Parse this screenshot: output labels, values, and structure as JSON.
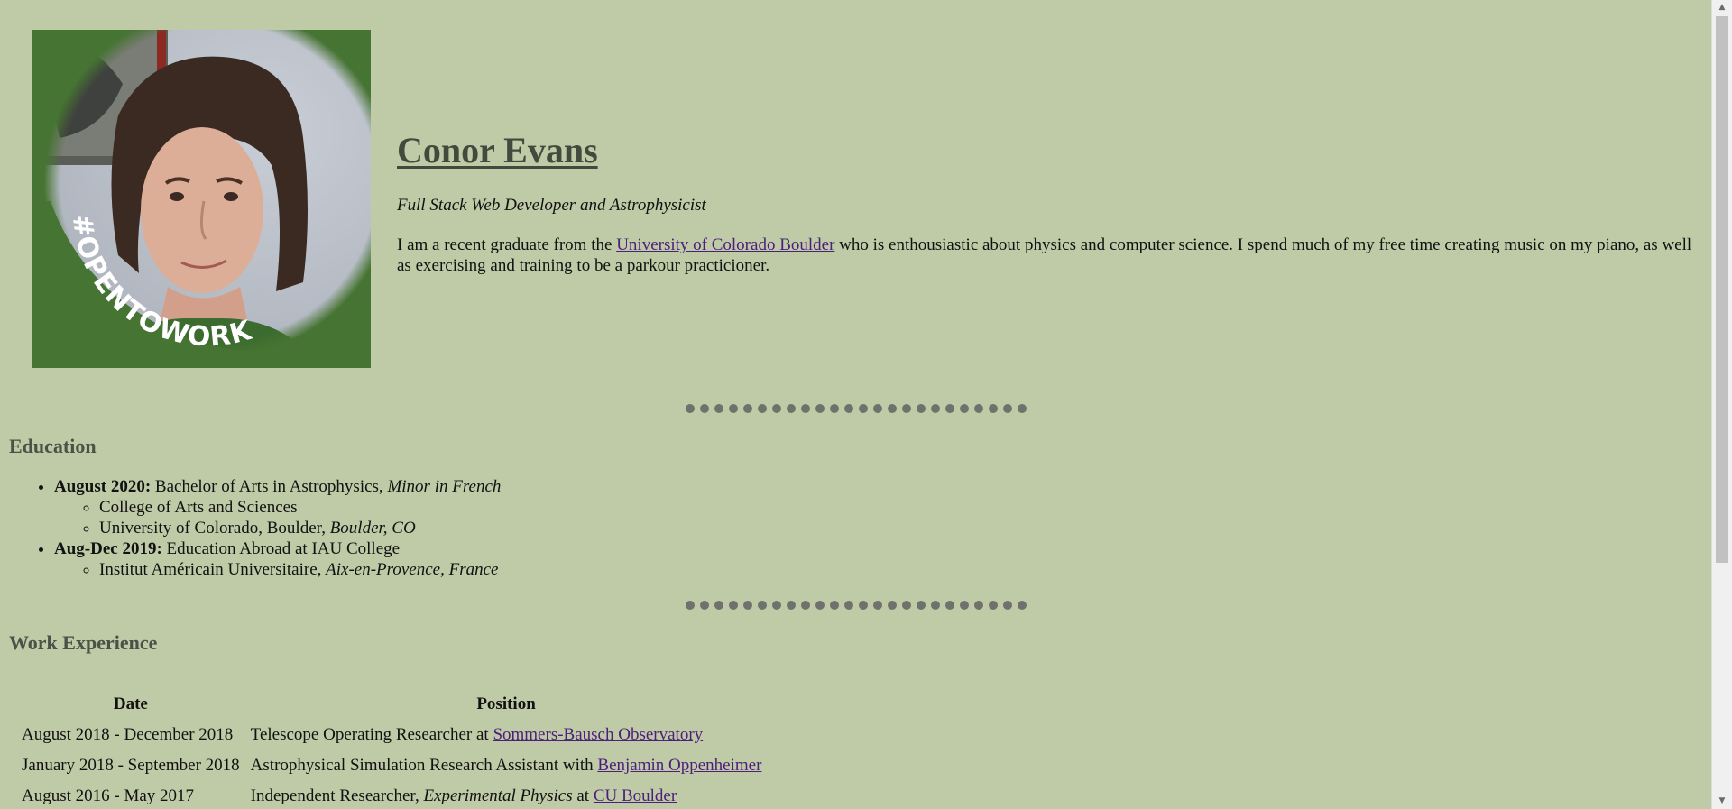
{
  "header": {
    "name": "Conor Evans",
    "subtitle": "Full Stack Web Developer and Astrophysicist",
    "bio_before_link": "I am a recent graduate from the ",
    "bio_link": "University of Colorado Boulder",
    "bio_after_link": " who is enthousiastic about physics and computer science. I spend much of my free time creating music on my piano, as well as exercising and training to be a parkour practicioner.",
    "photo_badge": "#OPENTOWORK"
  },
  "education": {
    "title": "Education",
    "items": [
      {
        "date": "August 2020:",
        "text": " Bachelor of Arts in Astrophysics, ",
        "emph": "Minor in French",
        "sub": [
          {
            "text": "College of Arts and Sciences",
            "emph": ""
          },
          {
            "text": "University of Colorado, Boulder, ",
            "emph": "Boulder, CO"
          }
        ]
      },
      {
        "date": "Aug-Dec 2019:",
        "text": " Education Abroad at IAU College",
        "emph": "",
        "sub": [
          {
            "text": "Institut Américain Universitaire, ",
            "emph": "Aix-en-Provence, France"
          }
        ]
      }
    ]
  },
  "work": {
    "title": "Work Experience",
    "headers": [
      "Date",
      "Position"
    ],
    "rows": [
      {
        "date": "August 2018 - December 2018",
        "pre": "Telescope Operating Researcher at ",
        "emph": "",
        "mid": "",
        "link": "Sommers-Bausch Observatory"
      },
      {
        "date": "January 2018 - September 2018",
        "pre": "Astrophysical Simulation Research Assistant with ",
        "emph": "",
        "mid": "",
        "link": "Benjamin Oppenheimer"
      },
      {
        "date": "August 2016 - May 2017",
        "pre": "Independent Researcher, ",
        "emph": "Experimental Physics",
        "mid": " at ",
        "link": "CU Boulder"
      }
    ]
  },
  "colors": {
    "background": "#bfcaa7",
    "heading": "#4b5146",
    "link": "#4b1f7a",
    "badge_green": "#467432"
  },
  "icons": {
    "divider_dot": "dot-icon",
    "scroll_up": "arrow-up-icon",
    "scroll_down": "arrow-down-icon"
  }
}
